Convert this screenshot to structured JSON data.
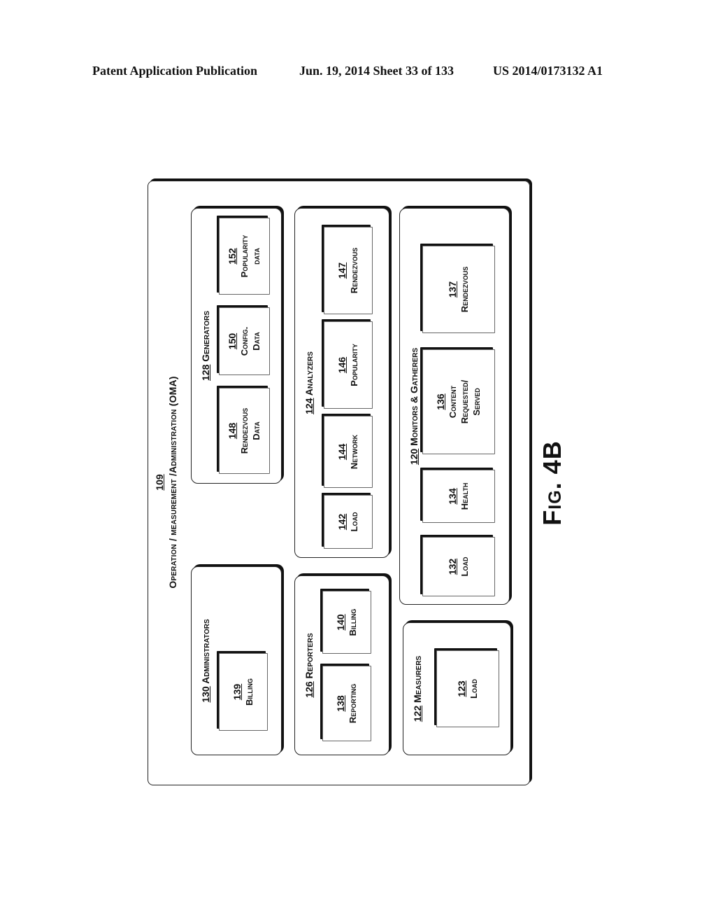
{
  "header": {
    "publication": "Patent Application Publication",
    "date_sheet": "Jun. 19, 2014  Sheet 33 of 133",
    "patent_number": "US 2014/0173132 A1"
  },
  "diagram": {
    "ref": "109",
    "title": "Operation / measurement /Administration (OMA)",
    "groups": {
      "administrators": {
        "ref": "130",
        "label": "Administrators",
        "items": [
          {
            "ref": "139",
            "lines": [
              "Billing"
            ]
          }
        ]
      },
      "generators": {
        "ref": "128",
        "label": "Generators",
        "items": [
          {
            "ref": "148",
            "lines": [
              "Rendezvous",
              "Data"
            ]
          },
          {
            "ref": "150",
            "lines": [
              "Config.",
              "Data"
            ]
          },
          {
            "ref": "152",
            "lines": [
              "Popularity",
              "data"
            ]
          }
        ]
      },
      "reporters": {
        "ref": "126",
        "label": "Reporters",
        "items": [
          {
            "ref": "138",
            "lines": [
              "Reporting"
            ]
          },
          {
            "ref": "140",
            "lines": [
              "Billing"
            ]
          }
        ]
      },
      "analyzers": {
        "ref": "124",
        "label": "Analyzers",
        "items": [
          {
            "ref": "142",
            "lines": [
              "Load"
            ]
          },
          {
            "ref": "144",
            "lines": [
              "Network"
            ]
          },
          {
            "ref": "146",
            "lines": [
              "Popularity"
            ]
          },
          {
            "ref": "147",
            "lines": [
              "Rendezvous"
            ]
          }
        ]
      },
      "measurers": {
        "ref": "122",
        "label": "Measurers",
        "items": [
          {
            "ref": "123",
            "lines": [
              "Load"
            ]
          }
        ]
      },
      "monitors": {
        "ref": "120",
        "label": "Monitors & Gatherers",
        "items": [
          {
            "ref": "132",
            "lines": [
              "Load"
            ]
          },
          {
            "ref": "134",
            "lines": [
              "Health"
            ]
          },
          {
            "ref": "136",
            "lines": [
              "Content",
              "Requested/",
              "Served"
            ]
          },
          {
            "ref": "137",
            "lines": [
              "Rendezvous"
            ]
          }
        ]
      }
    }
  },
  "figure_label": "Fig. 4B"
}
